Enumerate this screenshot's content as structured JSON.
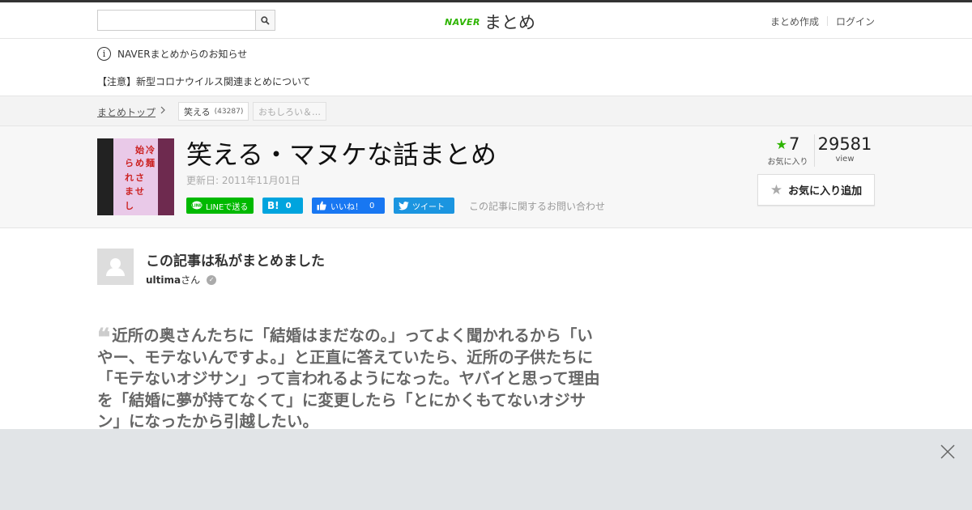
{
  "header": {
    "search_placeholder": "",
    "logo_brand": "NAVER",
    "logo_name": "まとめ",
    "nav_create": "まとめ作成",
    "nav_login": "ログイン"
  },
  "notice": {
    "info_glyph": "i",
    "title": "NAVERまとめからのお知らせ",
    "message": "【注意】新型コロナウイルス関連まとめについて"
  },
  "breadcrumb": {
    "top": "まとめトップ",
    "tag1_label": "笑える",
    "tag1_count": "(43287)",
    "tag2_label": "おもしろい＆…"
  },
  "article": {
    "thumb_text": [
      "始",
      "冷",
      "ら",
      "め",
      "麺",
      "れ",
      "さ",
      "ま",
      "せ",
      "し"
    ],
    "title": "笑える・マヌケな話まとめ",
    "updated": "更新日: 2011年11月01日",
    "share_line": "LINEで送る",
    "share_hatena_label": "B!",
    "share_hatena_count": "0",
    "share_fb_label": "いいね！",
    "share_fb_count": "0",
    "share_tw": "ツイート",
    "contact": "この記事に関するお問い合わせ"
  },
  "stats": {
    "fav_count": "7",
    "fav_label": "お気に入り",
    "view_count": "29581",
    "view_label": "view",
    "fav_button": "お気に入り追加"
  },
  "author": {
    "heading": "この記事は私がまとめました",
    "username": "ultima",
    "suffix": "さん"
  },
  "quote": {
    "mark": "❝",
    "text": "近所の奥さんたちに「結婚はまだなの。」ってよく聞かれるから「いやー、モテないんですよ。」と正直に答えていたら、近所の子供たちに「モテないオジサン」って言われるようになった。ヤバイと思って理由を「結婚に夢が持てなくて」に変更したら「とにかくもてないオジサン」になったから引越したい。"
  },
  "colors": {
    "naver_green": "#2db400",
    "line_green": "#00b900",
    "hatena_blue": "#00a4de",
    "facebook_blue": "#1877f2",
    "twitter_blue": "#1b95e0",
    "ad_background": "#e1e4e7"
  },
  "icons": {
    "search": "search-icon",
    "info": "info-icon",
    "star": "star-icon",
    "close": "close-icon",
    "verified": "verified-check-icon"
  }
}
